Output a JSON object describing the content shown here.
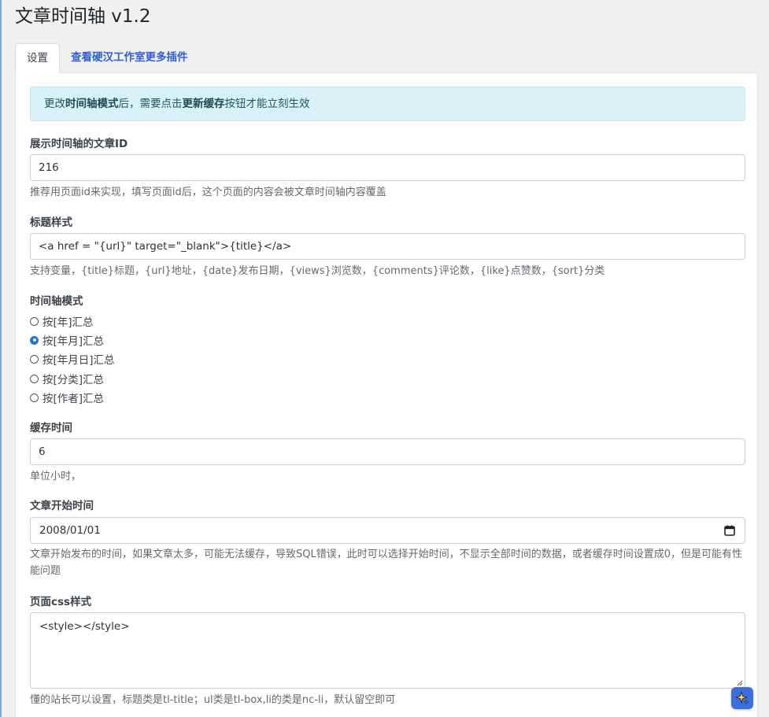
{
  "page": {
    "title": "文章时间轴 v1.2"
  },
  "tabs": [
    {
      "label": "设置",
      "active": true
    },
    {
      "label": "查看硬汉工作室更多插件",
      "active": false
    }
  ],
  "alert": {
    "pre": "更改",
    "bold1": "时间轴模式",
    "mid": "后，需要点击",
    "bold2": "更新缓存",
    "post": "按钮才能立刻生效"
  },
  "fields": {
    "post_id": {
      "label": "展示时间轴的文章ID",
      "value": "216",
      "help": "推荐用页面id来实现，填写页面id后，这个页面的内容会被文章时间轴内容覆盖"
    },
    "title_style": {
      "label": "标题样式",
      "value": "<a href = \"{url}\" target=\"_blank\">{title}</a>",
      "help": "支持变量，{title}标题，{url}地址，{date}发布日期，{views}浏览数，{comments}评论数，{like}点赞数，{sort}分类"
    },
    "timeline_mode": {
      "label": "时间轴模式",
      "options": [
        "按[年]汇总",
        "按[年月]汇总",
        "按[年月日]汇总",
        "按[分类]汇总",
        "按[作者]汇总"
      ],
      "selected_index": 1
    },
    "cache_time": {
      "label": "缓存时间",
      "value": "6",
      "help": "单位小时，"
    },
    "start_date": {
      "label": "文章开始时间",
      "value": "2008/01/01",
      "help": "文章开始发布的时间，如果文章太多，可能无法缓存，导致SQL错误，此时可以选择开始时间，不显示全部时间的数据，或者缓存时间设置成0，但是可能有性能问题"
    },
    "page_css": {
      "label": "页面css样式",
      "value": "<style></style>",
      "help": "懂的站长可以设置，标题类是tl-title；ul类是tl-box,li的类是nc-li，默认留空即可"
    }
  },
  "colors": {
    "accent": "#1a73e8",
    "link": "#2f5fd0",
    "alert_bg": "#d7f1f5"
  },
  "icons": {
    "calendar": "calendar-icon",
    "ai_assistant": "sparkle-icon"
  }
}
